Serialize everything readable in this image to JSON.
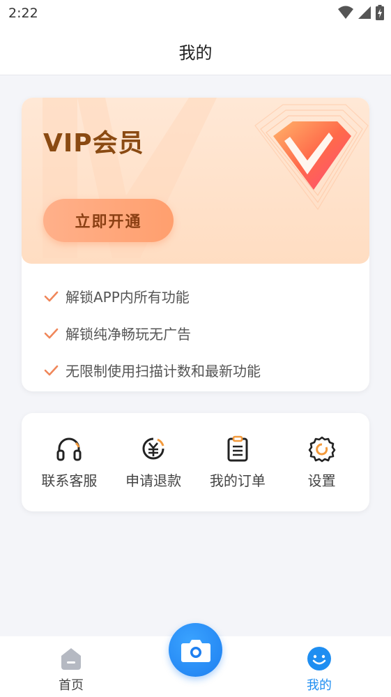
{
  "status_bar": {
    "time": "2:22"
  },
  "header": {
    "title": "我的"
  },
  "vip": {
    "title": "VIP会员",
    "button_label": "立即开通",
    "benefits": [
      "解锁APP内所有功能",
      "解锁纯净畅玩无广告",
      "无限制使用扫描计数和最新功能"
    ]
  },
  "menu": {
    "items": [
      {
        "label": "联系客服",
        "icon": "headset-icon"
      },
      {
        "label": "申请退款",
        "icon": "yuan-refund-icon"
      },
      {
        "label": "我的订单",
        "icon": "clipboard-icon"
      },
      {
        "label": "设置",
        "icon": "gear-icon"
      }
    ]
  },
  "tab_bar": {
    "home_label": "首页",
    "mine_label": "我的",
    "active_tab": "我的"
  },
  "colors": {
    "accent": "#1f8ef1",
    "vip_text": "#8a4a12",
    "check": "#f0875a",
    "button": "#ff9f6e"
  }
}
